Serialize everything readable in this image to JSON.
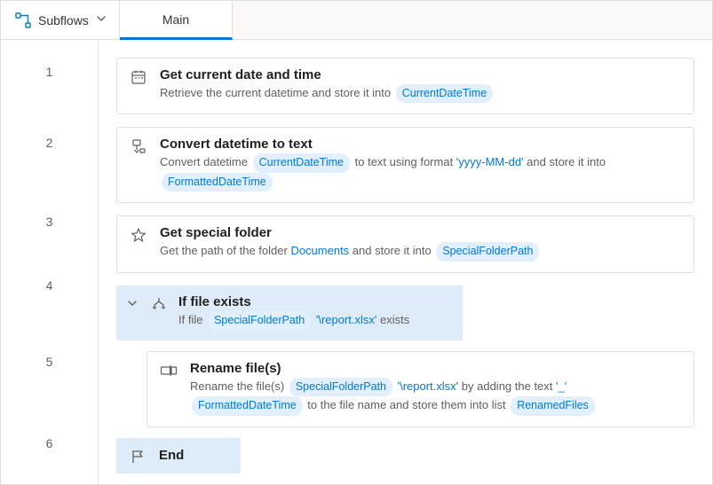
{
  "toolbar": {
    "subflows_label": "Subflows",
    "tab_main": "Main"
  },
  "lines": {
    "l1": "1",
    "l2": "2",
    "l3": "3",
    "l4": "4",
    "l5": "5",
    "l6": "6"
  },
  "steps": {
    "s1": {
      "title": "Get current date and time",
      "pre": "Retrieve the current datetime and store it into ",
      "var": "CurrentDateTime"
    },
    "s2": {
      "title": "Convert datetime to text",
      "pre": "Convert datetime ",
      "var1": "CurrentDateTime",
      "mid": " to text using format ",
      "fmt": "'yyyy-MM-dd'",
      "post": " and store it into ",
      "var2": "FormattedDateTime"
    },
    "s3": {
      "title": "Get special folder",
      "pre": "Get the path of the folder ",
      "folder": "Documents",
      "mid": " and store it into ",
      "var": "SpecialFolderPath"
    },
    "s4": {
      "title": "If file exists",
      "pre": "If file ",
      "var": "SpecialFolderPath",
      "lit": "'\\report.xlsx'",
      "post": " exists"
    },
    "s5": {
      "title": "Rename file(s)",
      "pre": "Rename the file(s) ",
      "var1": "SpecialFolderPath",
      "lit1": "'\\report.xlsx'",
      "mid1": " by adding the text ",
      "lit2": "'_'",
      "var2": "FormattedDateTime",
      "mid2": " to the file name and store them into list ",
      "var3": "RenamedFiles"
    },
    "s6": {
      "title": "End"
    }
  }
}
